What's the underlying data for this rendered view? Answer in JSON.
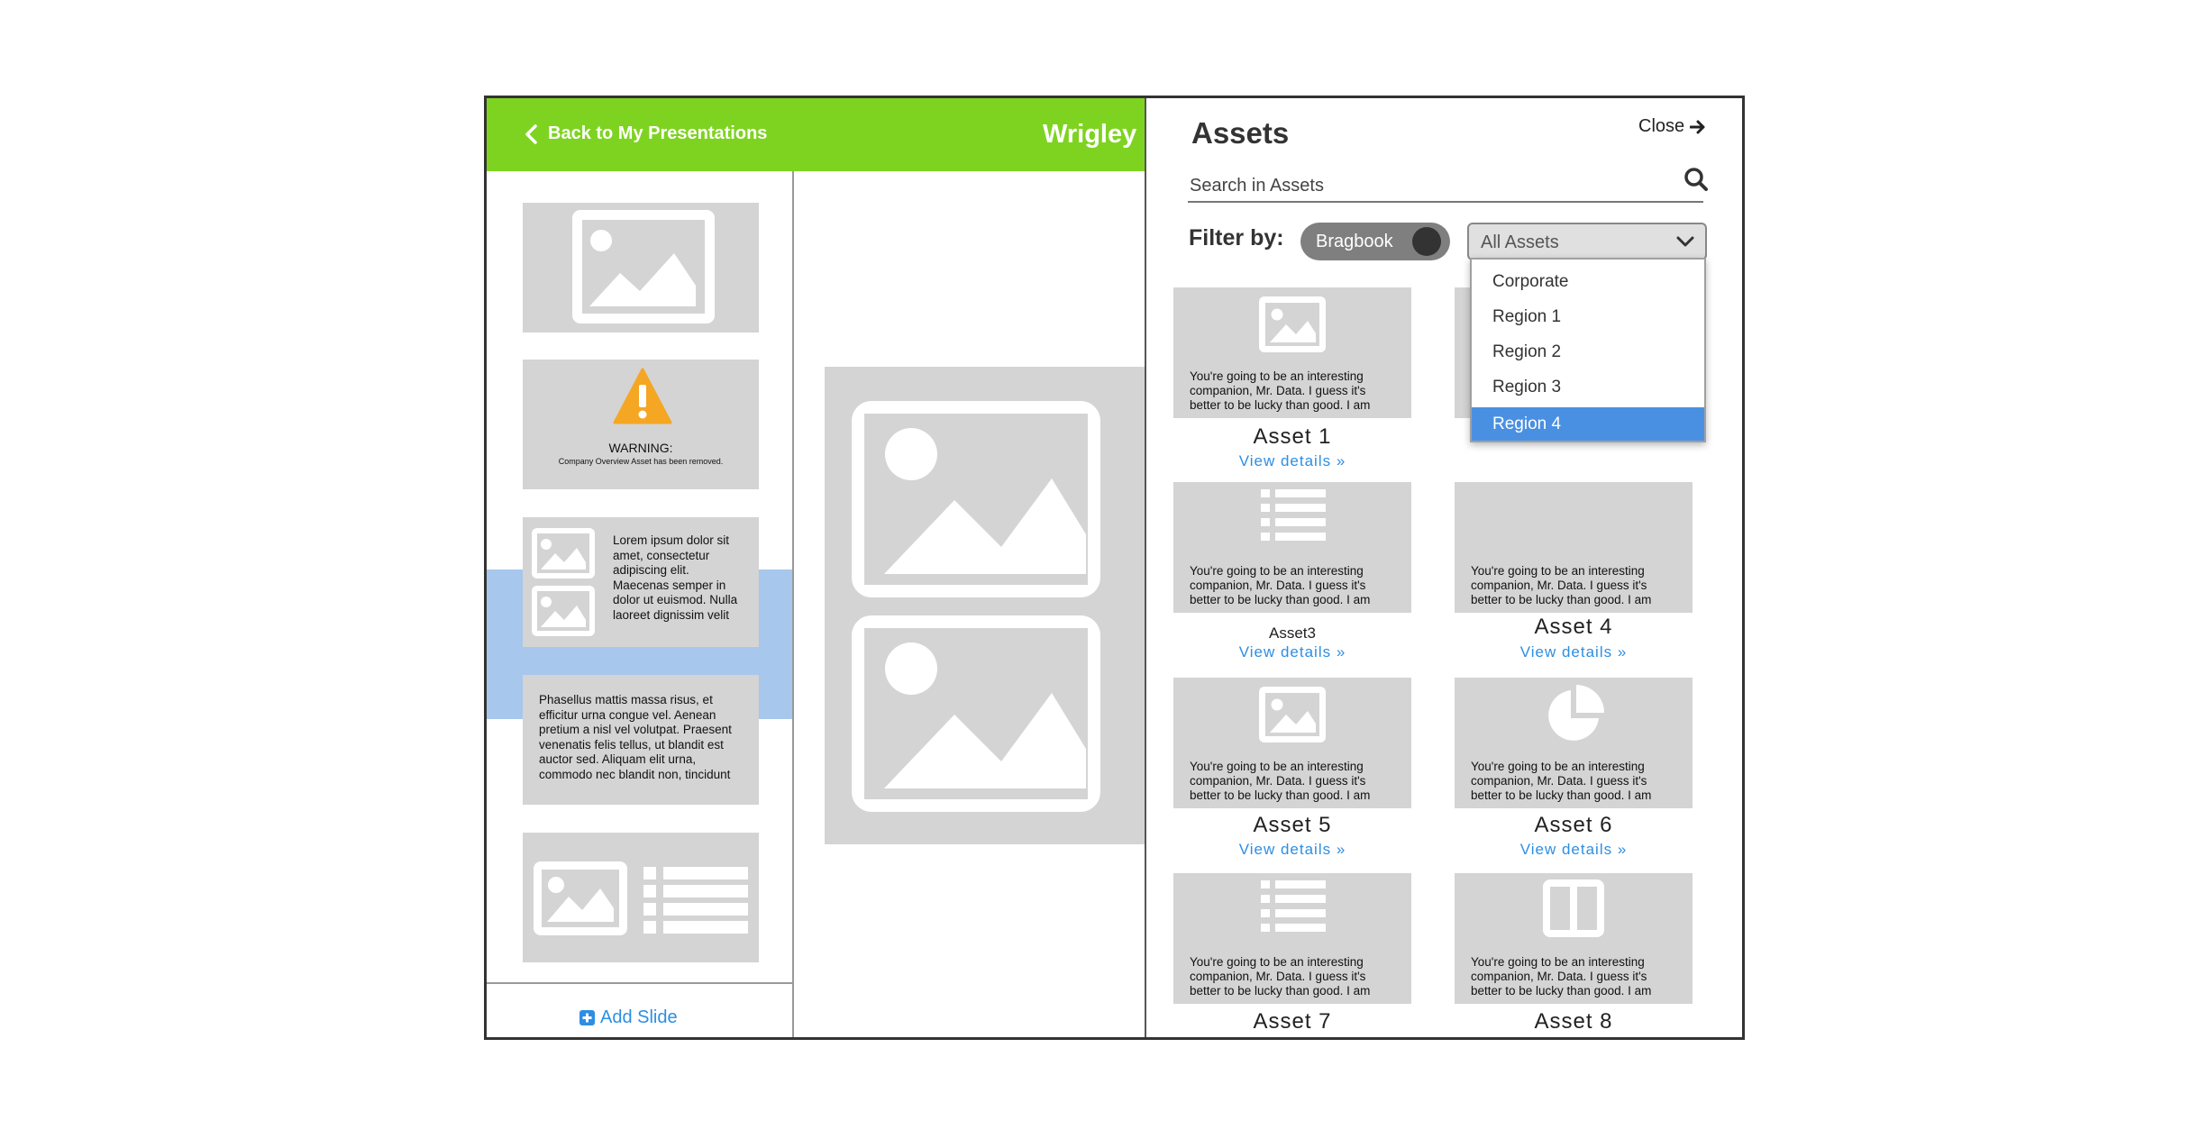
{
  "header": {
    "back_label": "Back to My Presentations",
    "presentation_title": "Wrigley F"
  },
  "slides": {
    "warning_title": "WARNING:",
    "warning_message": "Company Overview Asset has been removed.",
    "slide3_text": [
      "Lorem ipsum dolor sit",
      "amet, consectetur",
      "adipiscing elit.",
      "Maecenas semper in",
      "dolor ut euismod. Nulla",
      "laoreet dignissim velit"
    ],
    "slide4_text": [
      "Phasellus mattis massa risus, et",
      "efficitur urna congue vel. Aenean",
      "pretium a nisl vel volutpat. Praesent",
      "venenatis felis tellus, ut blandit est",
      "auctor sed. Aliquam elit urna,",
      "commodo nec blandit non, tincidunt"
    ],
    "add_slide_label": "Add Slide"
  },
  "assets_panel": {
    "title": "Assets",
    "close_label": "Close",
    "search_placeholder": "Search in Assets",
    "filter_label": "Filter by:",
    "toggle_label": "Bragbook",
    "dropdown": {
      "selected": "All Assets",
      "options": [
        "Corporate",
        "Region 1",
        "Region 2",
        "Region 3",
        "Region 4"
      ],
      "highlighted": "Region 4"
    },
    "description": [
      "You're going to be an interesting",
      "companion, Mr. Data. I guess it's",
      "better to be lucky than good. I am"
    ],
    "view_details": "View details »",
    "assets": [
      {
        "name": "Asset 1",
        "icon": "image-icon"
      },
      {
        "name": "Asset3",
        "icon": "list-icon"
      },
      {
        "name": "Asset 4",
        "icon": "list-icon"
      },
      {
        "name": "Asset 5",
        "icon": "image-icon"
      },
      {
        "name": "Asset 6",
        "icon": "pie-chart-icon"
      },
      {
        "name": "Asset 7",
        "icon": "list-icon"
      },
      {
        "name": "Asset 8",
        "icon": "two-column-icon"
      }
    ]
  },
  "colors": {
    "header_green": "#7ed321",
    "link_blue": "#2d8ee3",
    "selected_slide": "#a7c7ec",
    "selected_option": "#4a90e2",
    "placeholder_gray": "#d4d4d4",
    "warning_orange": "#f5a623"
  }
}
